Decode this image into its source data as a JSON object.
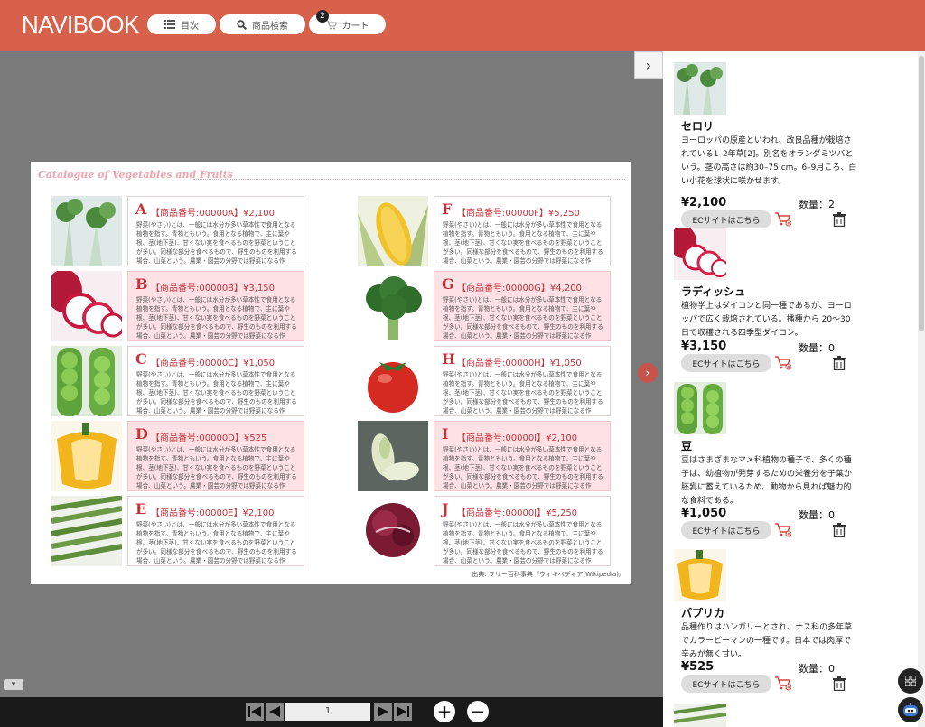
{
  "header": {
    "logo": "NAVIBOOK",
    "toc_label": "目次",
    "search_label": "商品検索",
    "cart_label": "カート",
    "cart_count": "2",
    "bg_color": "#d8614b"
  },
  "page": {
    "catalog_title": "Catalogue of Vegetables and Fruits",
    "description": "野菜(やさい)とは、一般には水分が多い草本性で食用となる植物を指す。青物ともいう。食用となる植物で、主に葉や根、茎(地下茎)、甘くない実を食べるものを野菜ということが多い。同様な部分を食べるもので、野生のものを利用する場合、山菜という。農業・園芸の分野では野菜になる作",
    "source": "出典: フリー百科事典『ウィキペディア(Wikipedia)』",
    "left_items": [
      {
        "letter": "A",
        "name": "【商品番号:00000A】¥2,100",
        "icon": "celery-image"
      },
      {
        "letter": "B",
        "name": "【商品番号:00000B】¥3,150",
        "icon": "radish-image"
      },
      {
        "letter": "C",
        "name": "【商品番号:00000C】¥1,050",
        "icon": "beans-image"
      },
      {
        "letter": "D",
        "name": "【商品番号:00000D】¥525",
        "icon": "paprika-image"
      },
      {
        "letter": "E",
        "name": "【商品番号:00000E】¥2,100",
        "icon": "asparagus-image"
      }
    ],
    "right_items": [
      {
        "letter": "F",
        "name": "【商品番号:00000F】¥5,250",
        "icon": "corn-image"
      },
      {
        "letter": "G",
        "name": "【商品番号:00000G】¥4,200",
        "icon": "broccoli-image"
      },
      {
        "letter": "H",
        "name": "【商品番号:00000H】¥1,050",
        "icon": "tomato-image"
      },
      {
        "letter": "I",
        "name": "【商品番号:00000I】¥2,100",
        "icon": "endive-image"
      },
      {
        "letter": "J",
        "name": "【商品番号:00000J】¥5,250",
        "icon": "radicchio-image"
      }
    ]
  },
  "footer": {
    "page_number": "1"
  },
  "cart_panel": {
    "ec_label": "ECサイトはこちら",
    "items": [
      {
        "name": "セロリ",
        "text": "ヨーロッパの原産といわれ、改良品種が栽培されている1–2年草[2]。別名をオランダミツバという。茎の高さは約30–75 cm。6–9月ころ、白い小花を球状に咲かせます。",
        "price": "¥2,100",
        "qty": "数量：2"
      },
      {
        "name": "ラディッシュ",
        "text": "植物学上はダイコンと同一種であるが、ヨーロッパで広く栽培されている。播種から 20〜30日で収穫される四季型ダイコン。",
        "price": "¥3,150",
        "qty": "数量：0"
      },
      {
        "name": "豆",
        "text": "豆はさまざまなマメ科植物の種子で、多くの種子は、幼植物が発芽するための栄養分を子葉か胚乳に蓄えているため、動物から見れば魅力的な食料である。",
        "price": "¥1,050",
        "qty": "数量：0"
      },
      {
        "name": "パプリカ",
        "text": "品種作りはハンガリーとされ、ナス科の多年草でカラーピーマンの一種です。日本では肉厚で辛みが無く甘い。",
        "price": "¥525",
        "qty": "数量：0"
      }
    ]
  }
}
